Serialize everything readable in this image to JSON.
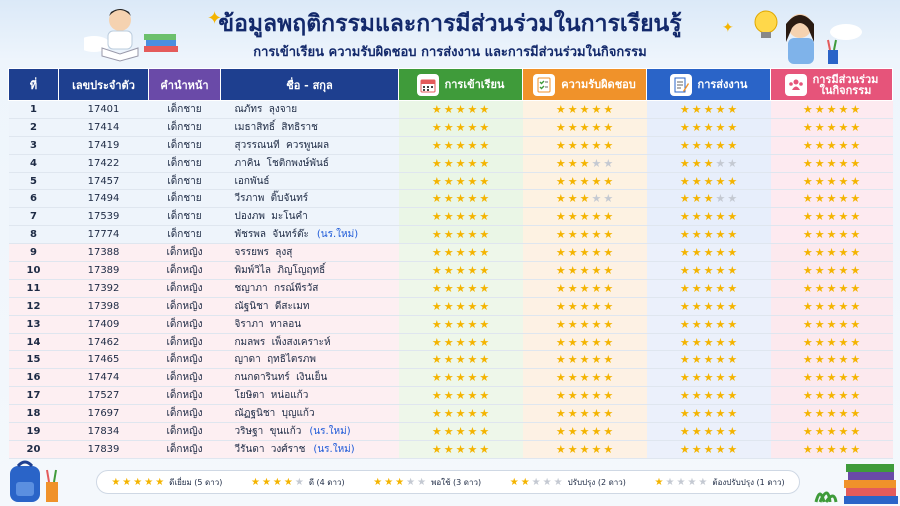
{
  "header": {
    "title": "ข้อมูลพฤติกรรมและการมีส่วนร่วมในการเรียนรู้",
    "subtitle": "การเข้าเรียน ความรับผิดชอบ การส่งงาน และการมีส่วนร่วมในกิจกรรม"
  },
  "columns": {
    "no": "ที่",
    "id": "เลขประจำตัว",
    "prefix": "คำนำหน้า",
    "name": "ชื่อ - สกุล",
    "attendance": "การเข้าเรียน",
    "responsibility": "ความรับผิดชอบ",
    "submission": "การส่งงาน",
    "participation_line1": "การมีส่วนร่วม",
    "participation_line2": "ในกิจกรรม"
  },
  "icons": {
    "attendance": "calendar-icon",
    "responsibility": "checklist-icon",
    "submission": "document-pen-icon",
    "participation": "group-icon"
  },
  "students": [
    {
      "no": "1",
      "id": "17401",
      "prefix": "เด็กชาย",
      "first": "ณภัทร",
      "last": "ลุงจาย",
      "tag": "",
      "gender": "boy",
      "ratings": [
        5,
        5,
        5,
        5
      ]
    },
    {
      "no": "2",
      "id": "17414",
      "prefix": "เด็กชาย",
      "first": "เมธาสิทธิ์",
      "last": "สิทธิราช",
      "tag": "",
      "gender": "boy",
      "ratings": [
        5,
        5,
        5,
        5
      ]
    },
    {
      "no": "3",
      "id": "17419",
      "prefix": "เด็กชาย",
      "first": "สุวรรณนที",
      "last": "ควรพูนผล",
      "tag": "",
      "gender": "boy",
      "ratings": [
        5,
        5,
        5,
        5
      ]
    },
    {
      "no": "4",
      "id": "17422",
      "prefix": "เด็กชาย",
      "first": "ภาคิน",
      "last": "โชติกพงษ์พันธ์",
      "tag": "",
      "gender": "boy",
      "ratings": [
        5,
        3,
        3,
        5
      ]
    },
    {
      "no": "5",
      "id": "17457",
      "prefix": "เด็กชาย",
      "first": "เอกพันธ์",
      "last": "",
      "tag": "",
      "gender": "boy",
      "ratings": [
        5,
        5,
        5,
        5
      ]
    },
    {
      "no": "6",
      "id": "17494",
      "prefix": "เด็กชาย",
      "first": "วีรภาพ",
      "last": "ติ๊บจันทร์",
      "tag": "",
      "gender": "boy",
      "ratings": [
        5,
        3,
        3,
        5
      ]
    },
    {
      "no": "7",
      "id": "17539",
      "prefix": "เด็กชาย",
      "first": "ปองภพ",
      "last": "มะโนคำ",
      "tag": "",
      "gender": "boy",
      "ratings": [
        5,
        5,
        5,
        5
      ]
    },
    {
      "no": "8",
      "id": "17774",
      "prefix": "เด็กชาย",
      "first": "พัชรพล",
      "last": "จันทร์ต๊ะ",
      "tag": "(นร.ใหม่)",
      "gender": "boy",
      "ratings": [
        5,
        5,
        5,
        5
      ]
    },
    {
      "no": "9",
      "id": "17388",
      "prefix": "เด็กหญิง",
      "first": "จรรยพร",
      "last": "ลุงสุ",
      "tag": "",
      "gender": "girl",
      "ratings": [
        5,
        5,
        5,
        5
      ]
    },
    {
      "no": "10",
      "id": "17389",
      "prefix": "เด็กหญิง",
      "first": "พิมพ์วิไล",
      "last": "ภิญโญฤทธิ์",
      "tag": "",
      "gender": "girl",
      "ratings": [
        5,
        5,
        5,
        5
      ]
    },
    {
      "no": "11",
      "id": "17392",
      "prefix": "เด็กหญิง",
      "first": "ชญาภา",
      "last": "กรณ์พีรวัส",
      "tag": "",
      "gender": "girl",
      "ratings": [
        5,
        5,
        5,
        5
      ]
    },
    {
      "no": "12",
      "id": "17398",
      "prefix": "เด็กหญิง",
      "first": "ณัฐนิชา",
      "last": "ดีสะเมท",
      "tag": "",
      "gender": "girl",
      "ratings": [
        5,
        5,
        5,
        5
      ]
    },
    {
      "no": "13",
      "id": "17409",
      "prefix": "เด็กหญิง",
      "first": "จิราภา",
      "last": "ทาลอน",
      "tag": "",
      "gender": "girl",
      "ratings": [
        5,
        5,
        5,
        5
      ]
    },
    {
      "no": "14",
      "id": "17462",
      "prefix": "เด็กหญิง",
      "first": "กมลพร",
      "last": "เพ็งสงเคราะห์",
      "tag": "",
      "gender": "girl",
      "ratings": [
        5,
        5,
        5,
        5
      ]
    },
    {
      "no": "15",
      "id": "17465",
      "prefix": "เด็กหญิง",
      "first": "ญาดา",
      "last": "ฤทธิไตรภพ",
      "tag": "",
      "gender": "girl",
      "ratings": [
        5,
        5,
        5,
        5
      ]
    },
    {
      "no": "16",
      "id": "17474",
      "prefix": "เด็กหญิง",
      "first": "กนกดารินทร์",
      "last": "เงินเย็น",
      "tag": "",
      "gender": "girl",
      "ratings": [
        5,
        5,
        5,
        5
      ]
    },
    {
      "no": "17",
      "id": "17527",
      "prefix": "เด็กหญิง",
      "first": "โยษิตา",
      "last": "หน่อแก้ว",
      "tag": "",
      "gender": "girl",
      "ratings": [
        5,
        5,
        5,
        5
      ]
    },
    {
      "no": "18",
      "id": "17697",
      "prefix": "เด็กหญิง",
      "first": "ณัฏฐนิชา",
      "last": "บุญแก้ว",
      "tag": "",
      "gender": "girl",
      "ratings": [
        5,
        5,
        5,
        5
      ]
    },
    {
      "no": "19",
      "id": "17834",
      "prefix": "เด็กหญิง",
      "first": "วริษฐา",
      "last": "ขุนแก้ว",
      "tag": "(นร.ใหม่)",
      "gender": "girl",
      "ratings": [
        5,
        5,
        5,
        5
      ]
    },
    {
      "no": "20",
      "id": "17839",
      "prefix": "เด็กหญิง",
      "first": "วีรันดา",
      "last": "วงศ์ราช",
      "tag": "(นร.ใหม่)",
      "gender": "girl",
      "ratings": [
        5,
        5,
        5,
        5
      ]
    }
  ],
  "legend": [
    {
      "stars": 5,
      "label": "ดีเยี่ยม (5 ดาว)"
    },
    {
      "stars": 4,
      "label": "ดี (4 ดาว)"
    },
    {
      "stars": 3,
      "label": "พอใช้ (3 ดาว)"
    },
    {
      "stars": 2,
      "label": "ปรับปรุง (2 ดาว)"
    },
    {
      "stars": 1,
      "label": "ต้องปรับปรุง (1 ดาว)"
    }
  ],
  "colors": {
    "title": "#13296b",
    "star_on": "#f4b400",
    "star_off": "#c4c9d2",
    "new_tag": "#1f5bd8",
    "attendance_header": "#3f9b3a",
    "responsibility_header": "#f0922a",
    "submission_header": "#2a64c8",
    "participation_header": "#e6547a"
  }
}
